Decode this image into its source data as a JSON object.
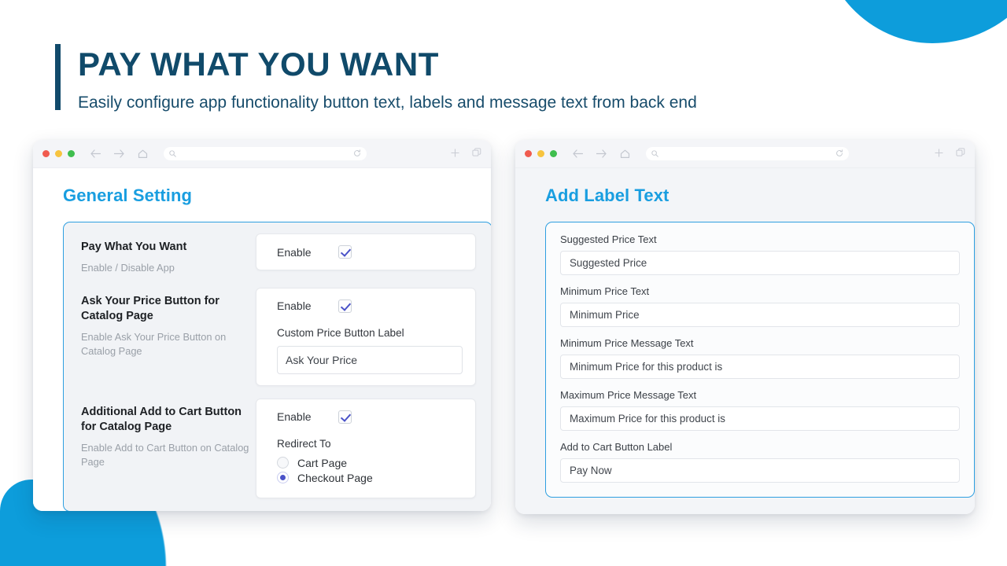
{
  "hero": {
    "title": "PAY WHAT YOU WANT",
    "subtitle": "Easily configure app functionality button text, labels and message text from back end",
    "accent_navy": "#104a6a",
    "accent_blue": "#0d9ddb"
  },
  "left_window": {
    "panel_title": "General Setting",
    "settings": [
      {
        "name": "Pay What You Want",
        "description": "Enable / Disable App",
        "enable_label": "Enable",
        "enable_checked": true
      },
      {
        "name": "Ask Your Price Button for Catalog Page",
        "description": "Enable Ask Your Price Button on Catalog Page",
        "enable_label": "Enable",
        "enable_checked": true,
        "field_label": "Custom Price Button Label",
        "field_value": "Ask Your Price"
      },
      {
        "name": "Additional Add to Cart Button for Catalog Page",
        "description": "Enable Add to Cart Button on Catalog Page",
        "enable_label": "Enable",
        "enable_checked": true,
        "radio_label": "Redirect To",
        "radio_options": [
          {
            "label": "Cart Page",
            "selected": false
          },
          {
            "label": "Checkout Page",
            "selected": true
          }
        ]
      }
    ]
  },
  "right_window": {
    "panel_title": "Add Label Text",
    "fields": [
      {
        "label": "Suggested Price Text",
        "value": "Suggested Price"
      },
      {
        "label": "Minimum Price Text",
        "value": "Minimum Price"
      },
      {
        "label": "Minimum Price Message Text",
        "value": "Minimum Price for this product is"
      },
      {
        "label": "Maximum Price Message Text",
        "value": "Maximum Price for this product is"
      },
      {
        "label": "Add to Cart Button Label",
        "value": "Pay Now"
      }
    ]
  },
  "browser_chrome": {
    "traffic_lights": [
      "close-red",
      "minimize-yellow",
      "maximize-green"
    ],
    "nav_icons": [
      "back-arrow-icon",
      "forward-arrow-icon",
      "home-icon"
    ],
    "url_icons": [
      "search-icon",
      "reload-icon"
    ],
    "right_icons": [
      "new-tab-plus-icon",
      "copy-tabs-icon"
    ]
  }
}
